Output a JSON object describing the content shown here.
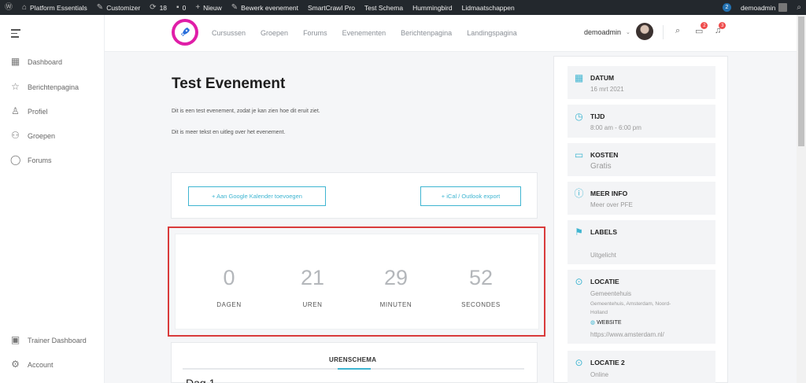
{
  "adminbar": {
    "site_name": "Platform Essentials",
    "customizer": "Customizer",
    "updates": "18",
    "comments": "0",
    "new": "Nieuw",
    "edit_event": "Bewerk evenement",
    "smartcrawl": "SmartCrawl Pro",
    "test_schema": "Test Schema",
    "hummingbird": "Hummingbird",
    "memberships": "Lidmaatschappen",
    "badge": "2",
    "user": "demoadmin"
  },
  "sidebar": {
    "items": [
      {
        "label": "Dashboard",
        "icon": "dashboard-icon"
      },
      {
        "label": "Berichtenpagina",
        "icon": "star-icon"
      },
      {
        "label": "Profiel",
        "icon": "user-icon"
      },
      {
        "label": "Groepen",
        "icon": "groups-icon"
      },
      {
        "label": "Forums",
        "icon": "forum-icon"
      }
    ],
    "bottom": [
      {
        "label": "Trainer Dashboard",
        "icon": "trainer-icon"
      },
      {
        "label": "Account",
        "icon": "gear-icon"
      }
    ]
  },
  "header": {
    "nav": [
      "Cursussen",
      "Groepen",
      "Forums",
      "Evenementen",
      "Berichtenpagina",
      "Landingspagina"
    ],
    "username": "demoadmin",
    "messages_count": "2",
    "notifications_count": "3"
  },
  "event": {
    "title": "Test Evenement",
    "desc1": "Dit is een test evenement, zodat je kan zien hoe dit eruit ziet.",
    "desc2": "Dit is meer tekst en uitleg over het evenement.",
    "google_btn": "+ Aan Google Kalender toevoegen",
    "ical_btn": "+ iCal / Outlook export"
  },
  "countdown": {
    "days": "0",
    "days_label": "DAGEN",
    "hours": "21",
    "hours_label": "UREN",
    "minutes": "29",
    "minutes_label": "MINUTEN",
    "seconds": "52",
    "seconds_label": "SECONDES"
  },
  "schedule": {
    "tab": "URENSCHEMA",
    "day": "Dag 1"
  },
  "details": {
    "datum_label": "DATUM",
    "datum_value": "16 mrt 2021",
    "tijd_label": "TIJD",
    "tijd_value": "8:00 am - 6:00 pm",
    "kosten_label": "KOSTEN",
    "kosten_value": "Gratis",
    "meer_label": "MEER INFO",
    "meer_value": "Meer over PFE",
    "labels_label": "LABELS",
    "labels_value": "Uitgelicht",
    "locatie_label": "LOCATIE",
    "locatie_name": "Gemeentehuis",
    "locatie_address1": "Gemeentehuis, Amsterdam, Noord-",
    "locatie_address2": "Holland",
    "website_label": "WEBSITE",
    "website_url": "https://www.amsterdam.nl/",
    "locatie2_label": "LOCATIE 2",
    "locatie2_value": "Online"
  },
  "colors": {
    "accent": "#3fb5d1",
    "highlight": "#d93b3b",
    "logo": "#e01ea8"
  }
}
